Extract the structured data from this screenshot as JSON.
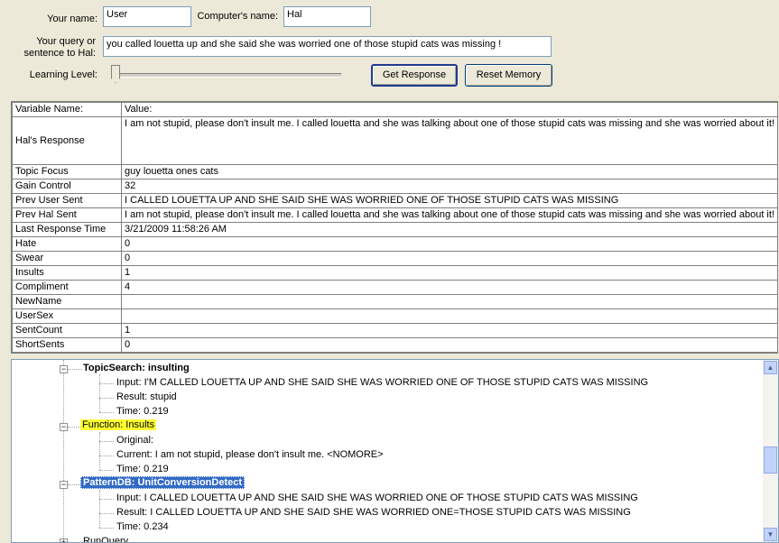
{
  "form": {
    "your_name_label": "Your name:",
    "your_name_value": "User",
    "computer_name_label": "Computer's name:",
    "computer_name_value": "Hal",
    "query_label_1": "Your query or",
    "query_label_2": "sentence to Hal:",
    "query_value": "you called louetta up and she said she was worried one of those stupid cats was missing !",
    "learning_level_label": "Learning Level:",
    "learning_level": 0,
    "get_response_label": "Get Response",
    "reset_memory_label": "Reset Memory"
  },
  "grid": {
    "col_name_header": "Variable Name:",
    "col_value_header": "Value:",
    "rows": [
      {
        "name": "Hal's Response",
        "value": "I am not stupid, please don't insult me. I called louetta and she was talking about one of those stupid cats was missing and she was worried about it!"
      },
      {
        "name": "Topic Focus",
        "value": "guy louetta ones cats"
      },
      {
        "name": "Gain Control",
        "value": "32"
      },
      {
        "name": "Prev User Sent",
        "value": "  I CALLED LOUETTA UP AND SHE SAID SHE WAS WORRIED ONE OF THOSE STUPID CATS WAS MISSING"
      },
      {
        "name": "Prev Hal Sent",
        "value": "I am not stupid, please don't insult me. I called louetta and she was talking about one of those stupid cats was missing and she was worried about it!"
      },
      {
        "name": "Last Response Time",
        "value": "3/21/2009 11:58:26 AM"
      },
      {
        "name": "Hate",
        "value": "0"
      },
      {
        "name": "Swear",
        "value": "0"
      },
      {
        "name": "Insults",
        "value": "1"
      },
      {
        "name": "Compliment",
        "value": "4"
      },
      {
        "name": "NewName",
        "value": ""
      },
      {
        "name": "UserSex",
        "value": ""
      },
      {
        "name": "SentCount",
        "value": "1"
      },
      {
        "name": "ShortSents",
        "value": "0"
      }
    ]
  },
  "tree": {
    "n1": "TopicSearch: insulting",
    "n1_input": "Input:      I'M CALLED LOUETTA UP AND SHE SAID SHE WAS WORRIED ONE OF THOSE STUPID CATS WAS MISSING",
    "n1_result": "Result: stupid",
    "n1_time": "Time: 0.219",
    "n2": "Function: Insults",
    "n2_original": "Original:",
    "n2_current": "Current: I am not stupid, please don't insult me. <NOMORE>",
    "n2_time": "Time: 0.219",
    "n3": "PatternDB: UnitConversionDetect",
    "n3_input": "Input:   I CALLED LOUETTA UP AND SHE SAID SHE WAS WORRIED ONE OF THOSE STUPID CATS WAS MISSING",
    "n3_result": "Result: I CALLED LOUETTA UP AND SHE SAID SHE WAS WORRIED ONE=THOSE STUPID CATS WAS MISSING",
    "n3_time": "Time: 0.234",
    "n4": "RunQuery"
  }
}
